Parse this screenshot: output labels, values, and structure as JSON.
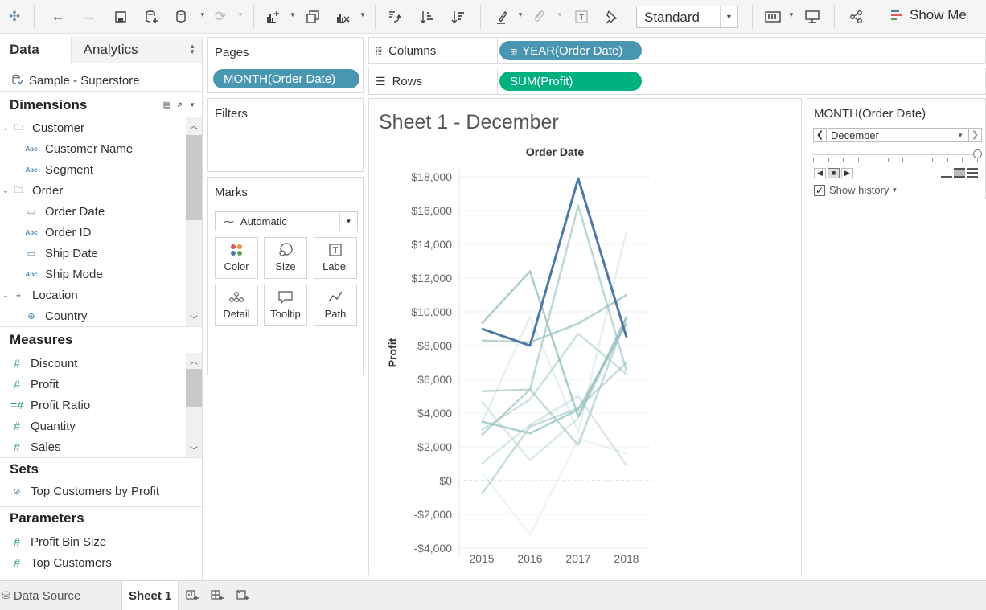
{
  "toolbar": {
    "fit_option": "Standard",
    "show_me_label": "Show Me"
  },
  "data_pane": {
    "tabs": [
      "Data",
      "Analytics"
    ],
    "datasource": "Sample - Superstore",
    "dimensions_label": "Dimensions",
    "dimensions": [
      {
        "label": "Customer",
        "kind": "folder"
      },
      {
        "label": "Customer Name",
        "kind": "string"
      },
      {
        "label": "Segment",
        "kind": "string"
      },
      {
        "label": "Order",
        "kind": "folder"
      },
      {
        "label": "Order Date",
        "kind": "date"
      },
      {
        "label": "Order ID",
        "kind": "string"
      },
      {
        "label": "Ship Date",
        "kind": "date"
      },
      {
        "label": "Ship Mode",
        "kind": "string"
      },
      {
        "label": "Location",
        "kind": "hierarchy"
      },
      {
        "label": "Country",
        "kind": "geo"
      }
    ],
    "measures_label": "Measures",
    "measures": [
      "Discount",
      "Profit",
      "Profit Ratio",
      "Quantity",
      "Sales"
    ],
    "sets_label": "Sets",
    "sets": [
      "Top Customers by Profit"
    ],
    "parameters_label": "Parameters",
    "parameters": [
      "Profit Bin Size",
      "Top Customers"
    ]
  },
  "cards": {
    "pages_label": "Pages",
    "pages_pill": "MONTH(Order Date)",
    "filters_label": "Filters",
    "marks_label": "Marks",
    "marks_type": "Automatic",
    "mark_buttons": [
      "Color",
      "Size",
      "Label",
      "Detail",
      "Tooltip",
      "Path"
    ]
  },
  "shelves": {
    "columns_label": "Columns",
    "columns_pill": "YEAR(Order Date)",
    "rows_label": "Rows",
    "rows_pill": "SUM(Profit)"
  },
  "view": {
    "sheet_title": "Sheet 1 - December"
  },
  "page_control": {
    "title": "MONTH(Order Date)",
    "value": "December",
    "show_history_label": "Show history",
    "show_history_checked": true
  },
  "bottom_tabs": {
    "data_source": "Data Source",
    "sheet": "Sheet 1"
  },
  "chart_data": {
    "type": "line",
    "title": "Order Date",
    "xlabel": "",
    "ylabel": "Profit",
    "categories": [
      "2015",
      "2016",
      "2017",
      "2018"
    ],
    "y_ticks": [
      "$18,000",
      "$16,000",
      "$14,000",
      "$12,000",
      "$10,000",
      "$8,000",
      "$6,000",
      "$4,000",
      "$2,000",
      "$0",
      "-$2,000",
      "-$4,000"
    ],
    "ylim": [
      -4000,
      18000
    ],
    "current_series": {
      "values": [
        9000,
        8000,
        17900,
        8500
      ],
      "color": "#4e79a7"
    },
    "history_series": [
      {
        "values": [
          9300,
          12400,
          3800,
          9700
        ],
        "opacity": 0.75
      },
      {
        "values": [
          8300,
          8200,
          9300,
          11000
        ],
        "opacity": 0.65
      },
      {
        "values": [
          2700,
          5400,
          16300,
          6500
        ],
        "opacity": 0.6
      },
      {
        "values": [
          3500,
          2800,
          4200,
          9300
        ],
        "opacity": 0.7
      },
      {
        "values": [
          5300,
          5400,
          2100,
          9700
        ],
        "opacity": 0.55
      },
      {
        "values": [
          -800,
          3200,
          4300,
          7000
        ],
        "opacity": 0.5
      },
      {
        "values": [
          3000,
          4800,
          8700,
          6300
        ],
        "opacity": 0.45
      },
      {
        "values": [
          1000,
          3300,
          5000,
          900
        ],
        "opacity": 0.35
      },
      {
        "values": [
          4700,
          1200,
          3700,
          9400
        ],
        "opacity": 0.3
      },
      {
        "values": [
          3400,
          9700,
          2900,
          14800
        ],
        "opacity": 0.22
      },
      {
        "values": [
          500,
          -3200,
          2500,
          1600
        ],
        "opacity": 0.15
      }
    ]
  }
}
